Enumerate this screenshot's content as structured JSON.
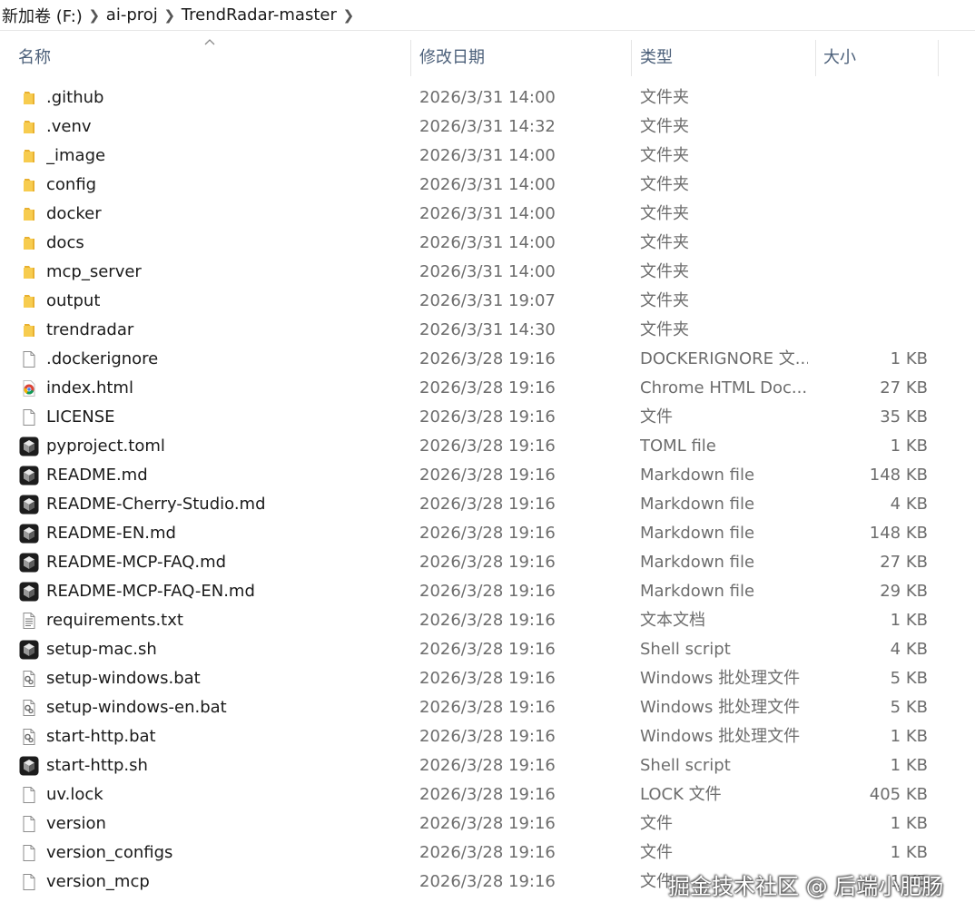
{
  "breadcrumb": {
    "items": [
      "新加卷 (F:)",
      "ai-proj",
      "TrendRadar-master"
    ]
  },
  "columns": {
    "name": "名称",
    "date": "修改日期",
    "type": "类型",
    "size": "大小"
  },
  "files": [
    {
      "name": ".github",
      "date": "2026/3/31 14:00",
      "type": "文件夹",
      "size": "",
      "icon": "folder-icon"
    },
    {
      "name": ".venv",
      "date": "2026/3/31 14:32",
      "type": "文件夹",
      "size": "",
      "icon": "folder-icon"
    },
    {
      "name": "_image",
      "date": "2026/3/31 14:00",
      "type": "文件夹",
      "size": "",
      "icon": "folder-icon"
    },
    {
      "name": "config",
      "date": "2026/3/31 14:00",
      "type": "文件夹",
      "size": "",
      "icon": "folder-icon"
    },
    {
      "name": "docker",
      "date": "2026/3/31 14:00",
      "type": "文件夹",
      "size": "",
      "icon": "folder-icon"
    },
    {
      "name": "docs",
      "date": "2026/3/31 14:00",
      "type": "文件夹",
      "size": "",
      "icon": "folder-icon"
    },
    {
      "name": "mcp_server",
      "date": "2026/3/31 14:00",
      "type": "文件夹",
      "size": "",
      "icon": "folder-icon"
    },
    {
      "name": "output",
      "date": "2026/3/31 19:07",
      "type": "文件夹",
      "size": "",
      "icon": "folder-icon"
    },
    {
      "name": "trendradar",
      "date": "2026/3/31 14:30",
      "type": "文件夹",
      "size": "",
      "icon": "folder-icon"
    },
    {
      "name": ".dockerignore",
      "date": "2026/3/28 19:16",
      "type": "DOCKERIGNORE 文...",
      "size": "1 KB",
      "icon": "file-icon"
    },
    {
      "name": "index.html",
      "date": "2026/3/28 19:16",
      "type": "Chrome HTML Doc...",
      "size": "27 KB",
      "icon": "chrome-icon"
    },
    {
      "name": "LICENSE",
      "date": "2026/3/28 19:16",
      "type": "文件",
      "size": "35 KB",
      "icon": "file-icon"
    },
    {
      "name": "pyproject.toml",
      "date": "2026/3/28 19:16",
      "type": "TOML file",
      "size": "1 KB",
      "icon": "editor-app-icon"
    },
    {
      "name": "README.md",
      "date": "2026/3/28 19:16",
      "type": "Markdown file",
      "size": "148 KB",
      "icon": "editor-app-icon"
    },
    {
      "name": "README-Cherry-Studio.md",
      "date": "2026/3/28 19:16",
      "type": "Markdown file",
      "size": "4 KB",
      "icon": "editor-app-icon"
    },
    {
      "name": "README-EN.md",
      "date": "2026/3/28 19:16",
      "type": "Markdown file",
      "size": "148 KB",
      "icon": "editor-app-icon"
    },
    {
      "name": "README-MCP-FAQ.md",
      "date": "2026/3/28 19:16",
      "type": "Markdown file",
      "size": "27 KB",
      "icon": "editor-app-icon"
    },
    {
      "name": "README-MCP-FAQ-EN.md",
      "date": "2026/3/28 19:16",
      "type": "Markdown file",
      "size": "29 KB",
      "icon": "editor-app-icon"
    },
    {
      "name": "requirements.txt",
      "date": "2026/3/28 19:16",
      "type": "文本文档",
      "size": "1 KB",
      "icon": "text-file-icon"
    },
    {
      "name": "setup-mac.sh",
      "date": "2026/3/28 19:16",
      "type": "Shell script",
      "size": "4 KB",
      "icon": "editor-app-icon"
    },
    {
      "name": "setup-windows.bat",
      "date": "2026/3/28 19:16",
      "type": "Windows 批处理文件",
      "size": "5 KB",
      "icon": "batch-file-icon"
    },
    {
      "name": "setup-windows-en.bat",
      "date": "2026/3/28 19:16",
      "type": "Windows 批处理文件",
      "size": "5 KB",
      "icon": "batch-file-icon"
    },
    {
      "name": "start-http.bat",
      "date": "2026/3/28 19:16",
      "type": "Windows 批处理文件",
      "size": "1 KB",
      "icon": "batch-file-icon"
    },
    {
      "name": "start-http.sh",
      "date": "2026/3/28 19:16",
      "type": "Shell script",
      "size": "1 KB",
      "icon": "editor-app-icon"
    },
    {
      "name": "uv.lock",
      "date": "2026/3/28 19:16",
      "type": "LOCK 文件",
      "size": "405 KB",
      "icon": "file-icon"
    },
    {
      "name": "version",
      "date": "2026/3/28 19:16",
      "type": "文件",
      "size": "1 KB",
      "icon": "file-icon"
    },
    {
      "name": "version_configs",
      "date": "2026/3/28 19:16",
      "type": "文件",
      "size": "1 KB",
      "icon": "file-icon"
    },
    {
      "name": "version_mcp",
      "date": "2026/3/28 19:16",
      "type": "文件",
      "size": "1 KB",
      "icon": "file-icon"
    }
  ],
  "watermark": "掘金技术社区 @ 后端小肥肠",
  "colors": {
    "folder": "#f5c445",
    "header_text": "#4c607a",
    "meta_text": "#6d6d6d"
  }
}
